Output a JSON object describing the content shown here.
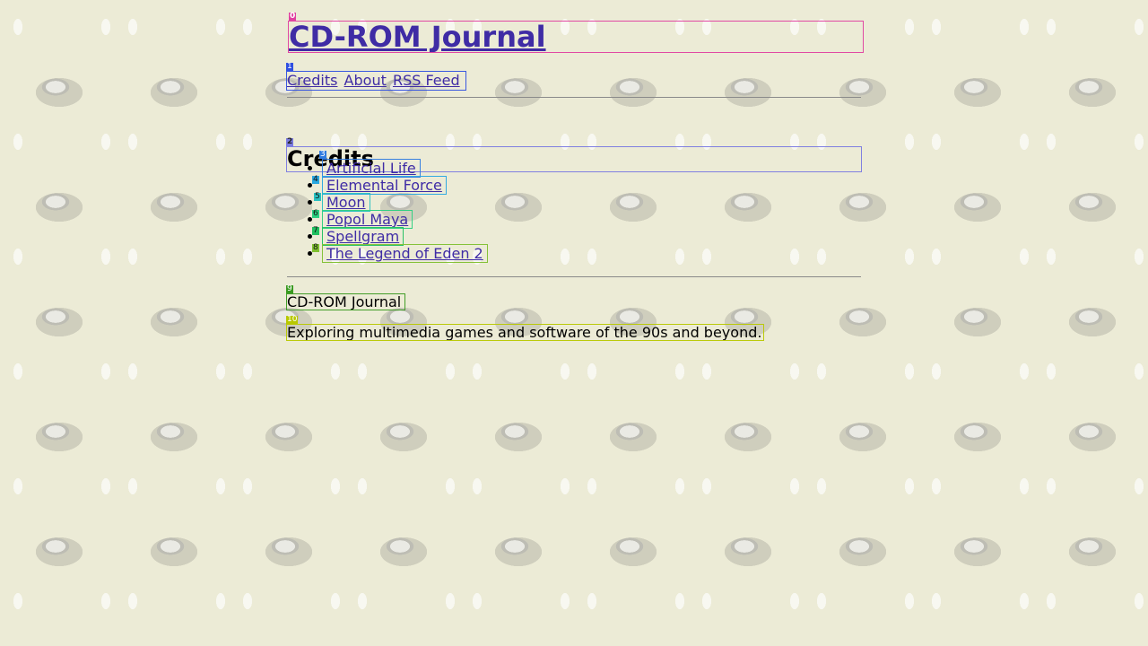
{
  "site": {
    "title": "CD-ROM Journal"
  },
  "nav": {
    "items": [
      {
        "label": "Credits"
      },
      {
        "label": "About"
      },
      {
        "label": "RSS Feed"
      }
    ]
  },
  "main": {
    "heading": "Credits",
    "list": [
      {
        "label": "Artificial Life"
      },
      {
        "label": "Elemental Force"
      },
      {
        "label": "Moon"
      },
      {
        "label": "Popol Maya"
      },
      {
        "label": "Spellgram"
      },
      {
        "label": "The Legend of Eden 2"
      }
    ]
  },
  "footer": {
    "title": "CD-ROM Journal",
    "description": "Exploring multimedia games and software of the 90s and beyond."
  },
  "overlay": {
    "tags": [
      "0",
      "1",
      "2",
      "3",
      "4",
      "5",
      "6",
      "7",
      "8",
      "9",
      "10"
    ],
    "colors": {
      "t0": "#e040a0",
      "t1": "#3050e0",
      "t2": "#7a7ae0",
      "t3": "#2f7be0",
      "t4": "#28a7e0",
      "t5": "#28c0c0",
      "t6": "#2bd080",
      "t7": "#20c060",
      "t8": "#80c030",
      "t9": "#3a9a20",
      "t10": "#b8c800"
    }
  }
}
